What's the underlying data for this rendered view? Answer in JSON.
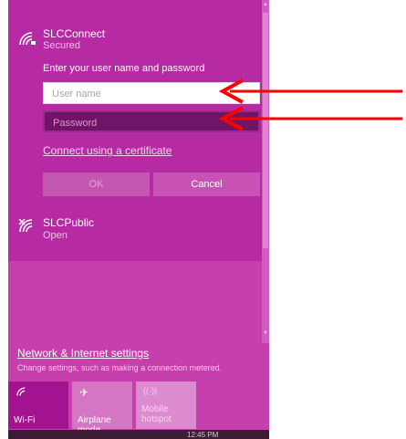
{
  "networks": [
    {
      "name": "SLCConnect",
      "status": "Secured"
    },
    {
      "name": "SLCPublic",
      "status": "Open"
    }
  ],
  "login": {
    "prompt": "Enter your user name and password",
    "username_placeholder": "User name",
    "password_placeholder": "Password",
    "certificate_link": "Connect using a certificate",
    "ok_label": "OK",
    "cancel_label": "Cancel"
  },
  "settings": {
    "link": "Network & Internet settings",
    "description": "Change settings, such as making a connection metered."
  },
  "quick_actions": {
    "wifi": "Wi-Fi",
    "airplane": "Airplane mode",
    "hotspot_line1": "Mobile",
    "hotspot_line2": "hotspot"
  },
  "taskbar": {
    "time": "12:45 PM"
  },
  "colors": {
    "panel": "#c53fad",
    "panel_expanded": "#b62aa4",
    "annotation_arrow": "#ff0000"
  },
  "icons": {
    "wifi": "wifi-icon",
    "airplane": "airplane-icon",
    "hotspot": "hotspot-icon"
  }
}
